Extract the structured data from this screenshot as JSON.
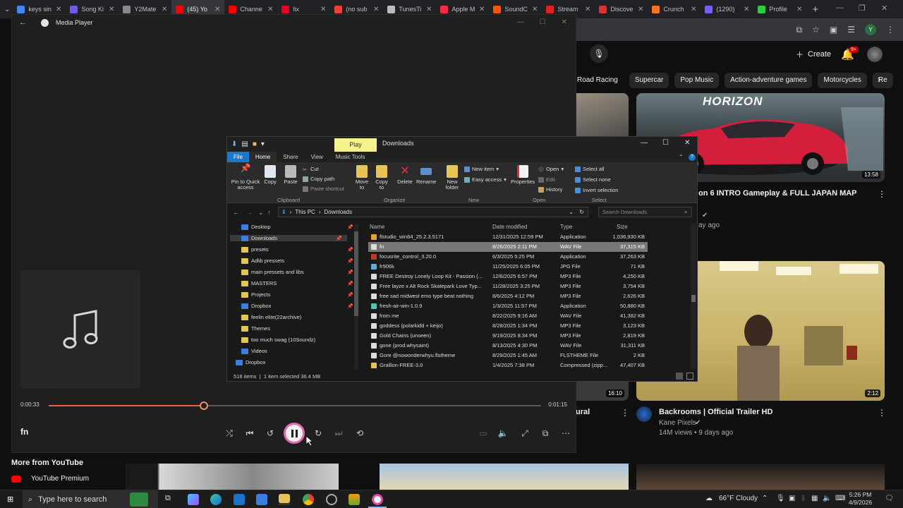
{
  "browser": {
    "tabs": [
      {
        "label": "keys sin",
        "color": "#4285f4",
        "active": false
      },
      {
        "label": "Song Ki",
        "color": "#6b5be8",
        "active": false
      },
      {
        "label": "Y2Mate",
        "color": "#888888",
        "active": false
      },
      {
        "label": "(45) Yo",
        "color": "#ff0000",
        "active": true
      },
      {
        "label": "Channe",
        "color": "#ff0000",
        "active": false
      },
      {
        "label": "lix",
        "color": "#e60023",
        "active": false
      },
      {
        "label": "(no sub",
        "color": "#ea4335",
        "active": false
      },
      {
        "label": "TunesTi",
        "color": "#bbbbbb",
        "active": false
      },
      {
        "label": "Apple M",
        "color": "#fa2d48",
        "active": false
      },
      {
        "label": "SoundC",
        "color": "#ff5500",
        "active": false
      },
      {
        "label": "Stream",
        "color": "#e02020",
        "active": false
      },
      {
        "label": "Discove",
        "color": "#e03030",
        "active": false
      },
      {
        "label": "Crunch",
        "color": "#f47521",
        "active": false
      },
      {
        "label": "(1290)",
        "color": "#7a5cff",
        "active": false
      },
      {
        "label": "Profile",
        "color": "#2ecc40",
        "active": false
      }
    ],
    "new_tab": "+",
    "profile_initial": "Y"
  },
  "youtube": {
    "create_label": "Create",
    "notif_count": "9+",
    "chips": [
      "Road Racing",
      "Supercar",
      "Pop Music",
      "Action-adventure games",
      "Motorcycles",
      "Re"
    ],
    "video1": {
      "thumb_text": "HORIZON",
      "duration": "13:58",
      "title": "on 6 INTRO Gameplay & FULL JAPAN MAP",
      "age": "ay ago"
    },
    "video2": {
      "duration": "2:12",
      "title": "Backrooms | Official Trailer HD",
      "channel": "Kane Pixels",
      "stats": "14M views • 9 days ago"
    },
    "partial": {
      "duration": "16:10",
      "title": "ural"
    },
    "more_from": "More from YouTube",
    "premium": "YouTube Premium"
  },
  "media_player": {
    "title": "Media Player",
    "song": "fn",
    "current_time": "0:00:33",
    "total_time": "0:01:15",
    "progress": 0.315
  },
  "explorer": {
    "context_tab": "Play",
    "folder_name": "Downloads",
    "tabs": [
      "File",
      "Home",
      "Share",
      "View",
      "Music Tools"
    ],
    "ribbon": {
      "pin": "Pin to Quick access",
      "copy": "Copy",
      "paste": "Paste",
      "cut": "Cut",
      "copy_path": "Copy path",
      "paste_shortcut": "Paste shortcut",
      "move_to": "Move to",
      "copy_to": "Copy to",
      "delete": "Delete",
      "rename": "Rename",
      "new_folder": "New folder",
      "new_item": "New item",
      "easy_access": "Easy access",
      "properties": "Properties",
      "open": "Open",
      "edit": "Edit",
      "history": "History",
      "select_all": "Select all",
      "select_none": "Select none",
      "invert_selection": "Invert selection",
      "groups": [
        "Clipboard",
        "Organize",
        "New",
        "Open",
        "Select"
      ]
    },
    "path": [
      "This PC",
      "Downloads"
    ],
    "search_placeholder": "Search Downloads",
    "nav_items": [
      {
        "label": "Desktop",
        "type": "blue",
        "pin": true
      },
      {
        "label": "Downloads",
        "type": "blue",
        "pin": true,
        "selected": true
      },
      {
        "label": "presets",
        "type": "folder",
        "pin": true
      },
      {
        "label": "Adlib pressets",
        "type": "folder",
        "pin": true
      },
      {
        "label": "main pressets and libs",
        "type": "folder",
        "pin": true
      },
      {
        "label": "MASTERS",
        "type": "folder",
        "pin": true
      },
      {
        "label": "Projects",
        "type": "folder",
        "pin": true
      },
      {
        "label": "Dropbox",
        "type": "blue",
        "pin": true
      },
      {
        "label": "feelin elite(22archive)",
        "type": "folder",
        "pin": false
      },
      {
        "label": "Themes",
        "type": "folder",
        "pin": false
      },
      {
        "label": "too much swag (10Soundz)",
        "type": "folder",
        "pin": false
      },
      {
        "label": "Videos",
        "type": "blue",
        "pin": false
      },
      {
        "label": "Dropbox",
        "type": "blue",
        "pin": false
      }
    ],
    "columns": {
      "name": "Name",
      "date": "Date modified",
      "type": "Type",
      "size": "Size"
    },
    "files": [
      {
        "name": "flstudio_win64_25.2.3.5171",
        "date": "12/31/2025 12:59 PM",
        "type": "Application",
        "size": "1,036,930 KB",
        "color": "#e8a030"
      },
      {
        "name": "fn",
        "date": "8/26/2025 2:11 PM",
        "type": "WAV File",
        "size": "37,315 KB",
        "color": "#dddddd",
        "selected": true
      },
      {
        "name": "focusrite_control_3.20.0",
        "date": "6/3/2025 5:25 PM",
        "type": "Application",
        "size": "37,263 KB",
        "color": "#c0392b"
      },
      {
        "name": "fr906k",
        "date": "11/25/2025 6:05 PM",
        "type": "JPG File",
        "size": "71 KB",
        "color": "#5dade2"
      },
      {
        "name": "FREE Destroy Lonely Loop Kit - Passion (...",
        "date": "12/6/2025 6:57 PM",
        "type": "MP3 File",
        "size": "4,250 KB",
        "color": "#dddddd"
      },
      {
        "name": "Free layze x Alt Rock  Skatepark Love Typ...",
        "date": "11/28/2025 3:25 PM",
        "type": "MP3 File",
        "size": "3,754 KB",
        "color": "#dddddd"
      },
      {
        "name": "free sad midwest emo type beat nothing",
        "date": "8/6/2025 4:12 PM",
        "type": "MP3 File",
        "size": "2,626 KB",
        "color": "#dddddd"
      },
      {
        "name": "fresh-air-win-1.0.9",
        "date": "1/3/2025 11:57 PM",
        "type": "Application",
        "size": "50,880 KB",
        "color": "#48c9b0"
      },
      {
        "name": "from me",
        "date": "8/22/2025 9:16 AM",
        "type": "WAV File",
        "size": "41,382 KB",
        "color": "#dddddd"
      },
      {
        "name": "goddess  (polarkidd + keijo)",
        "date": "8/28/2025 1:34 PM",
        "type": "MP3 File",
        "size": "3,123 KB",
        "color": "#dddddd"
      },
      {
        "name": "Gold Chains (unseen)",
        "date": "9/19/2025 8:34 PM",
        "type": "MP3 File",
        "size": "2,819 KB",
        "color": "#dddddd"
      },
      {
        "name": "gone (prod.whysaint)",
        "date": "8/13/2025 4:30 PM",
        "type": "WAV File",
        "size": "31,311 KB",
        "color": "#dddddd"
      },
      {
        "name": "Gore @nowonderwhyu.flstheme",
        "date": "8/29/2025 1:45 AM",
        "type": "FLSTHEME File",
        "size": "2 KB",
        "color": "#dddddd"
      },
      {
        "name": "Graillon-FREE-3.0",
        "date": "1/4/2025 7:38 PM",
        "type": "Compressed (zipp...",
        "size": "47,407 KB",
        "color": "#e8c35a"
      }
    ],
    "status": {
      "items": "518 items",
      "selected": "1 item selected  36.4 MB"
    }
  },
  "taskbar": {
    "search_placeholder": "Type here to search",
    "weather": "66°F  Cloudy",
    "time": "5:26 PM",
    "date": "4/9/2026"
  }
}
